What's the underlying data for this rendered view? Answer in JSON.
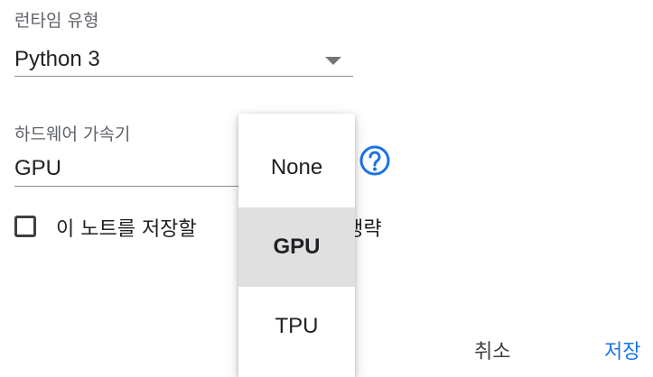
{
  "runtime": {
    "label": "런타임 유형",
    "value": "Python 3"
  },
  "accelerator": {
    "label": "하드웨어 가속기",
    "value": "GPU",
    "help_icon": "help-circle-icon",
    "options": [
      "None",
      "GPU",
      "TPU"
    ],
    "selected_option": "GPU"
  },
  "output_checkbox": {
    "label_before": "이 노트를 저장할 ",
    "label_after": "출력 생략",
    "checked": false
  },
  "actions": {
    "cancel_label": "취소",
    "save_label": "저장"
  },
  "colors": {
    "accent": "#1a73e8",
    "menu_selected_bg": "#e0e0e0"
  }
}
